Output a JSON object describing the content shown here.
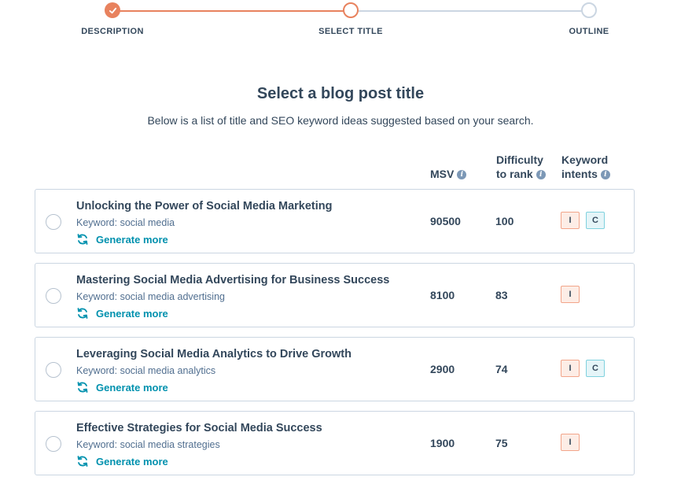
{
  "stepper": {
    "steps": [
      {
        "label": "DESCRIPTION",
        "state": "done"
      },
      {
        "label": "SELECT TITLE",
        "state": "active"
      },
      {
        "label": "OUTLINE",
        "state": "todo"
      }
    ]
  },
  "header": {
    "title": "Select a blog post title",
    "subtitle": "Below is a list of title and SEO keyword ideas suggested based on your search."
  },
  "columns": {
    "msv": "MSV",
    "difficulty_line1": "Difficulty",
    "difficulty_line2": "to rank",
    "intents_line1": "Keyword",
    "intents_line2": "intents"
  },
  "rows": [
    {
      "title": "Unlocking the Power of Social Media Marketing",
      "keyword": "Keyword: social media",
      "generate": "Generate more",
      "msv": "90500",
      "difficulty": "100",
      "intents": [
        "I",
        "C"
      ]
    },
    {
      "title": "Mastering Social Media Advertising for Business Success",
      "keyword": "Keyword: social media advertising",
      "generate": "Generate more",
      "msv": "8100",
      "difficulty": "83",
      "intents": [
        "I"
      ]
    },
    {
      "title": "Leveraging Social Media Analytics to Drive Growth",
      "keyword": "Keyword: social media analytics",
      "generate": "Generate more",
      "msv": "2900",
      "difficulty": "74",
      "intents": [
        "I",
        "C"
      ]
    },
    {
      "title": "Effective Strategies for Social Media Success",
      "keyword": "Keyword: social media strategies",
      "generate": "Generate more",
      "msv": "1900",
      "difficulty": "75",
      "intents": [
        "I"
      ]
    }
  ],
  "colors": {
    "accent": "#e8825e",
    "link": "#0091ae",
    "text": "#33475b",
    "border": "#cbd6e2"
  },
  "icons": {
    "step_done": "check-icon",
    "info": "info-icon",
    "generate": "refresh-icon"
  }
}
